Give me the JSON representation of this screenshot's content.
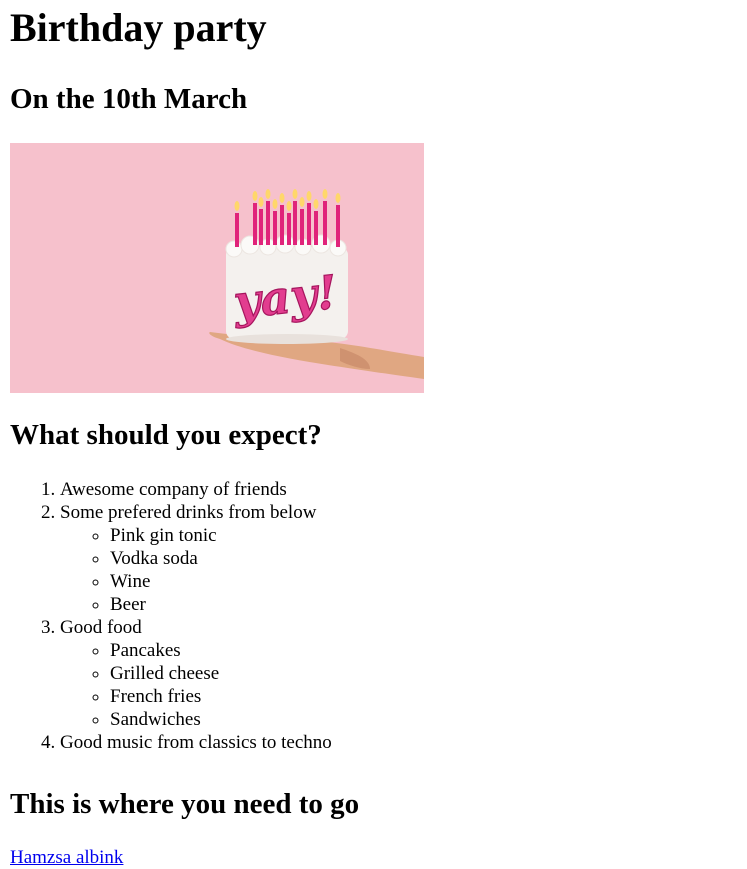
{
  "page": {
    "title": "Birthday party",
    "date_heading": "On the 10th March",
    "image": {
      "alt": "Birthday cake with lit candles and the word yay!",
      "cake_text": "yay!"
    },
    "expect_heading": "What should you expect?",
    "plan": [
      {
        "label": "Awesome company of friends",
        "sub": []
      },
      {
        "label": "Some prefered drinks from below",
        "sub": [
          "Pink gin tonic",
          "Vodka soda",
          "Wine",
          "Beer"
        ]
      },
      {
        "label": "Good food",
        "sub": [
          "Pancakes",
          "Grilled cheese",
          "French fries",
          "Sandwiches"
        ]
      },
      {
        "label": "Good music from classics to techno",
        "sub": []
      }
    ],
    "go_heading": "This is where you need to go",
    "location_link": "Hamzsa albink"
  },
  "colors": {
    "background": "#ffffff",
    "text": "#000000",
    "link": "#0000ee",
    "image_background": "#f6c1cc",
    "cake_white": "#f4f1ee",
    "candle_pink": "#e0237a",
    "hand": "#e0a782"
  }
}
